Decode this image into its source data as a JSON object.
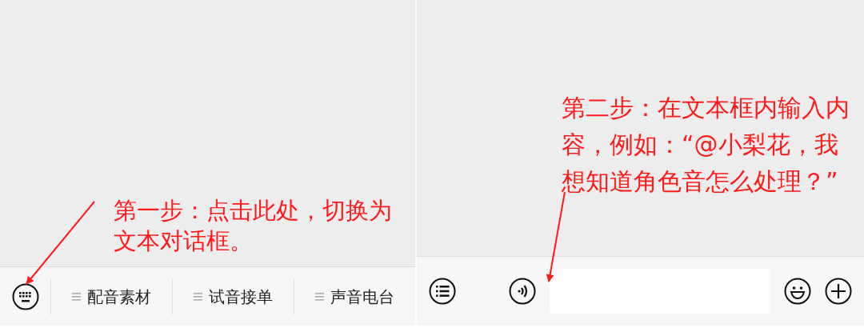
{
  "left_panel": {
    "annotation": "第一步：点击此处，切换为文本对话框。",
    "menu_items": [
      {
        "label": "配音素材"
      },
      {
        "label": "试音接单"
      },
      {
        "label": "声音电台"
      }
    ]
  },
  "right_panel": {
    "annotation": "第二步：在文本框内输入内容，例如：“@小梨花，我想知道角色音怎么处理？”"
  }
}
